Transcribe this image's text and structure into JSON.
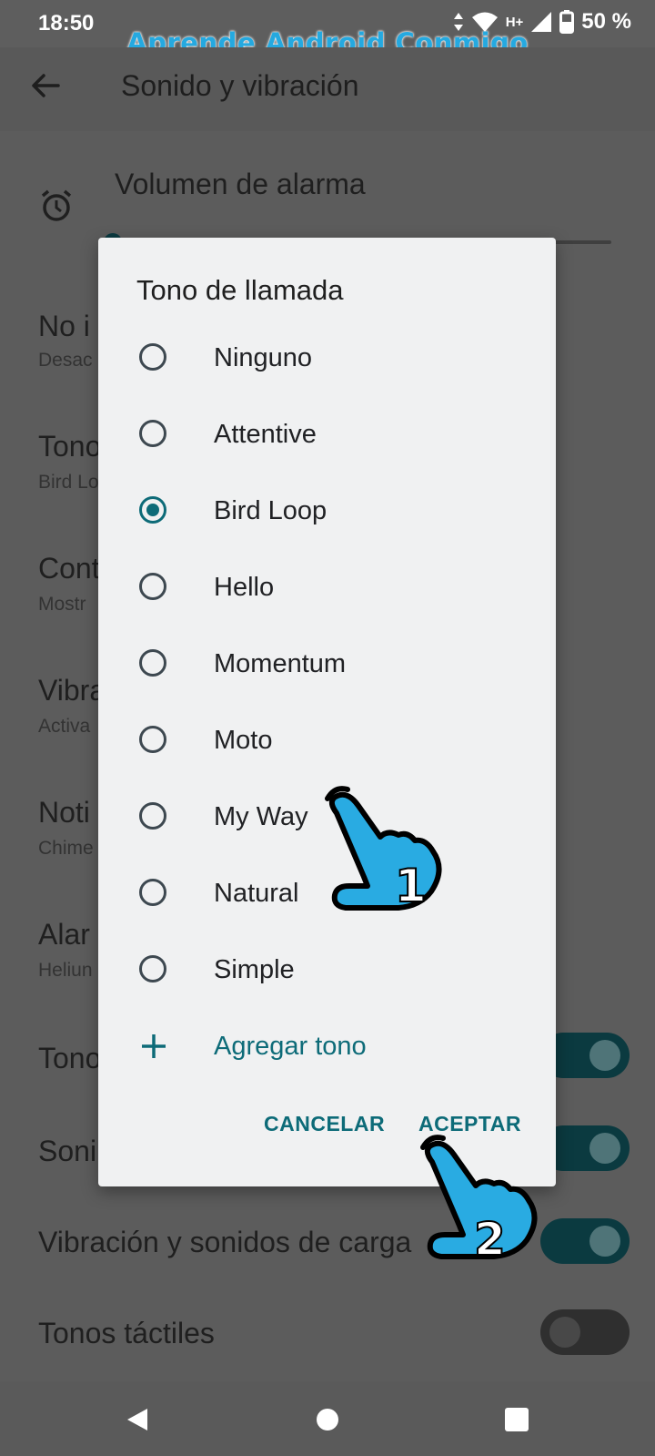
{
  "status_bar": {
    "time": "18:50",
    "network": "H+",
    "battery": "50 %"
  },
  "watermark": "Aprende Android Conmigo",
  "app_bar": {
    "title": "Sonido y vibración"
  },
  "settings": {
    "alarm_volume_title": "Volumen de alarma",
    "rows": [
      {
        "title": "No i",
        "subtitle": "Desac"
      },
      {
        "title": "Tono",
        "subtitle": "Bird Lo"
      },
      {
        "title": "Cont",
        "subtitle": "Mostr"
      },
      {
        "title": "Vibra",
        "subtitle": "Activa"
      },
      {
        "title": "Noti",
        "subtitle": "Chime"
      },
      {
        "title": "Alar",
        "subtitle": "Heliun"
      }
    ],
    "toggle_rows": [
      {
        "title": "Tono",
        "on": true
      },
      {
        "title": "Soni",
        "on": true
      },
      {
        "title": "Vibración y sonidos de carga",
        "on": true
      },
      {
        "title": "Tonos táctiles",
        "on": false
      }
    ]
  },
  "dialog": {
    "title": "Tono de llamada",
    "options": [
      "Ninguno",
      "Attentive",
      "Bird Loop",
      "Hello",
      "Momentum",
      "Moto",
      "My Way",
      "Natural",
      "Simple"
    ],
    "selected": "Bird Loop",
    "add_tone": "Agregar tono",
    "cancel": "CANCELAR",
    "ok": "ACEPTAR"
  },
  "annotations": {
    "step1": "1",
    "step2": "2"
  },
  "colors": {
    "accent": "#0d6b78",
    "watermark": "#25a9e0",
    "hand": "#29abe2"
  }
}
